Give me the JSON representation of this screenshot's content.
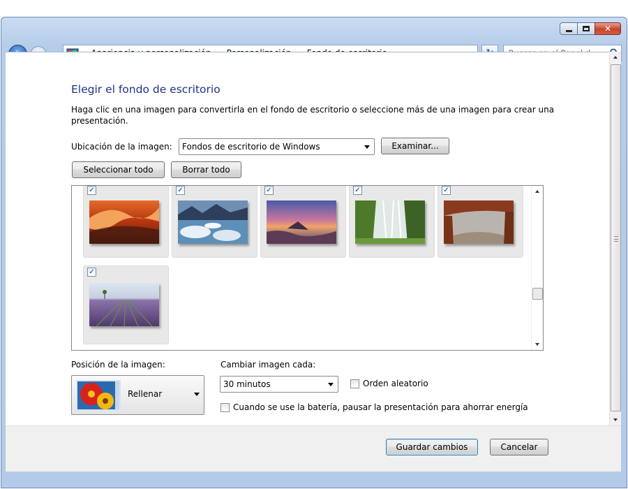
{
  "window": {
    "controls": {
      "minimize_icon": "minimize-icon",
      "maximize_icon": "maximize-icon",
      "close_icon": "close-icon",
      "close_glyph": "✕"
    }
  },
  "nav": {
    "breadcrumb_prefix": "«",
    "crumbs": [
      "Apariencia y personalización",
      "Personalización",
      "Fondo de escritorio"
    ],
    "crumb_separator": "▶",
    "refresh_glyph": "↻",
    "search_placeholder": "Buscar en el Panel d..."
  },
  "page": {
    "title": "Elegir el fondo de escritorio",
    "description": "Haga clic en una imagen para convertirla en el fondo de escritorio o seleccione más de una imagen para crear una presentación."
  },
  "location": {
    "label": "Ubicación de la imagen:",
    "selected": "Fondos de escritorio de Windows",
    "browse_button": "Examinar..."
  },
  "selection": {
    "select_all": "Seleccionar todo",
    "clear_all": "Borrar todo"
  },
  "gallery": {
    "check_glyph": "✓",
    "images": [
      {
        "name": "red-canyon",
        "checked": true
      },
      {
        "name": "icy-lake",
        "checked": true
      },
      {
        "name": "sunset-coast",
        "checked": true
      },
      {
        "name": "waterfall",
        "checked": true
      },
      {
        "name": "rock-arch",
        "checked": true
      },
      {
        "name": "lavender-field",
        "checked": true
      }
    ]
  },
  "position": {
    "label": "Posición de la imagen:",
    "selected": "Rellenar"
  },
  "interval": {
    "label": "Cambiar imagen cada:",
    "selected": "30 minutos",
    "shuffle_label": "Orden aleatorio",
    "shuffle_checked": false,
    "battery_label": "Cuando se use la batería, pausar la presentación para ahorrar energía",
    "battery_checked": false
  },
  "footer": {
    "save_button": "Guardar cambios",
    "cancel_button": "Cancelar"
  }
}
